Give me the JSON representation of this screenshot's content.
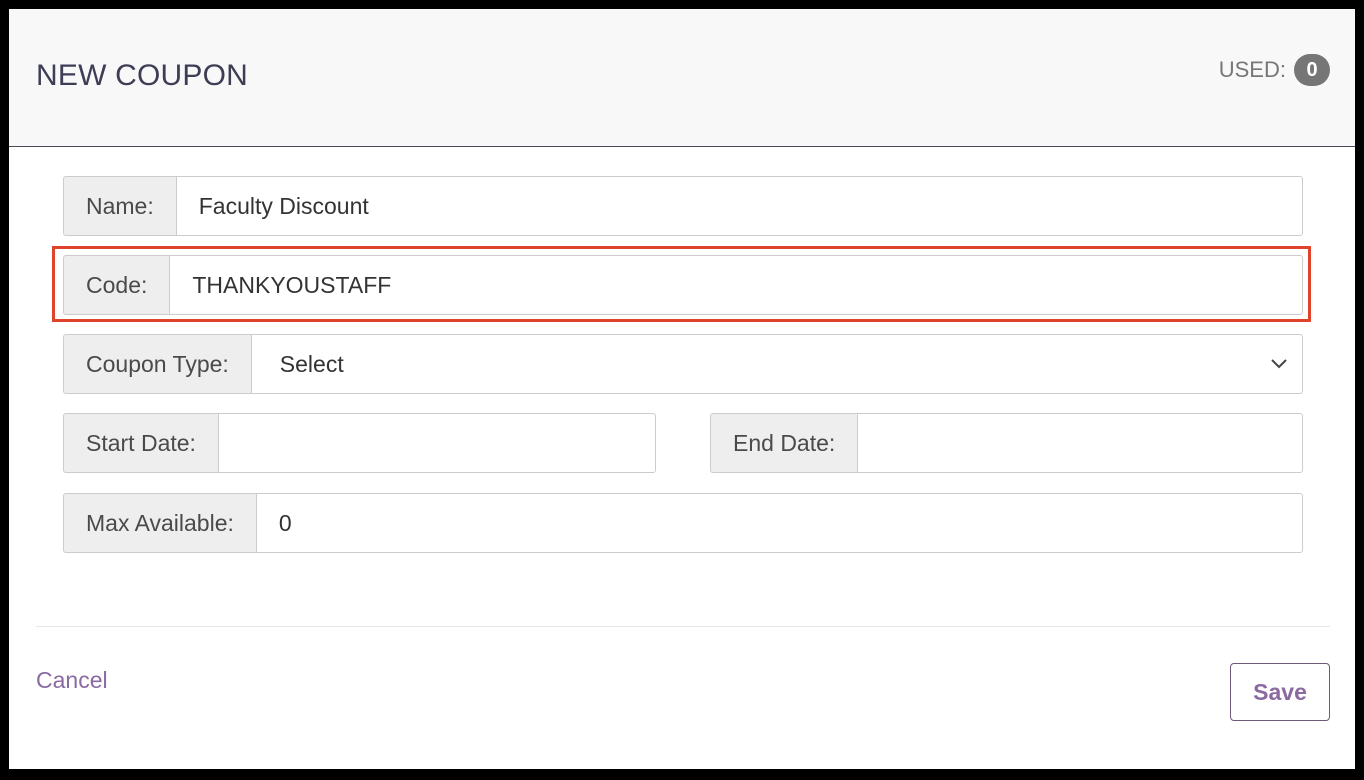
{
  "header": {
    "title": "NEW COUPON",
    "used_label": "USED:",
    "used_count": "0"
  },
  "form": {
    "name": {
      "label": "Name:",
      "value": "Faculty Discount"
    },
    "code": {
      "label": "Code:",
      "value": "THANKYOUSTAFF"
    },
    "coupon_type": {
      "label": "Coupon Type:",
      "value": "Select",
      "icon": "chevron-down-icon"
    },
    "start_date": {
      "label": "Start Date:",
      "value": ""
    },
    "end_date": {
      "label": "End Date:",
      "value": ""
    },
    "max_available": {
      "label": "Max Available:",
      "value": "0"
    }
  },
  "footer": {
    "cancel_label": "Cancel",
    "save_label": "Save"
  },
  "colors": {
    "highlight": "#e1432a",
    "accent": "#8a6aa0",
    "badge": "#767676"
  }
}
